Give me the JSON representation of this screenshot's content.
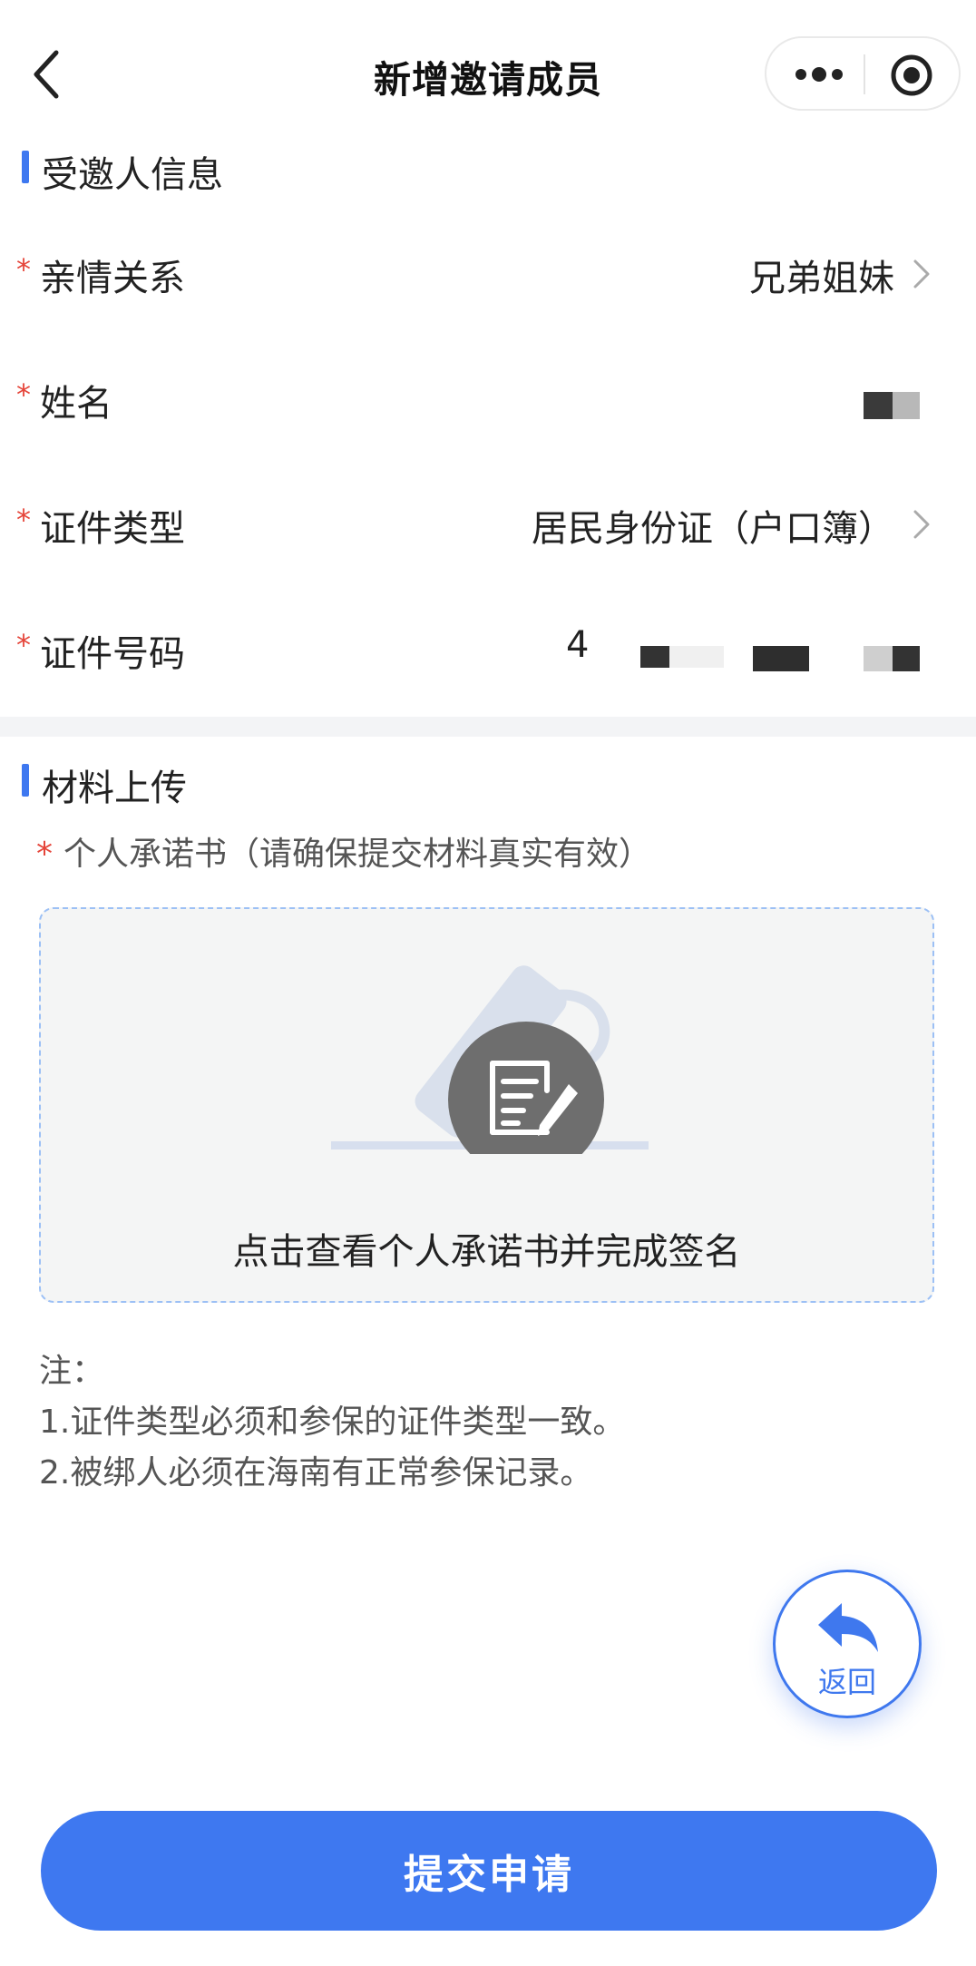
{
  "nav": {
    "title": "新增邀请成员",
    "back_icon": "chevron-left-icon",
    "more_icon": "more-dots-icon",
    "close_icon": "target-circle-icon"
  },
  "invitee_section": {
    "title": "受邀人信息",
    "fields": [
      {
        "label": "亲情关系",
        "value": "兄弟姐妹",
        "required": "*"
      },
      {
        "label": "姓名",
        "value": "",
        "required": "*"
      },
      {
        "label": "证件类型",
        "value": "居民身份证（户口簿）",
        "required": "*"
      },
      {
        "label": "证件号码",
        "value": "4",
        "required": "*"
      }
    ]
  },
  "material_section": {
    "title": "材料上传",
    "required": "*",
    "upload_label": "个人承诺书（请确保提交材料真实有效）",
    "upload_caption": "点击查看个人承诺书并完成签名",
    "upload_icon": "document-sign-icon"
  },
  "notes": {
    "heading": "注：",
    "line1": "1.证件类型必须和参保的证件类型一致。",
    "line2": "2.被绑人必须在海南有正常参保记录。"
  },
  "back_fab": {
    "label": "返回",
    "icon": "return-arrow-icon"
  },
  "submit": {
    "label": "提交申请"
  },
  "colors": {
    "accent": "#3e78f0",
    "required": "#e5453a",
    "divider": "#f3f4f6"
  }
}
